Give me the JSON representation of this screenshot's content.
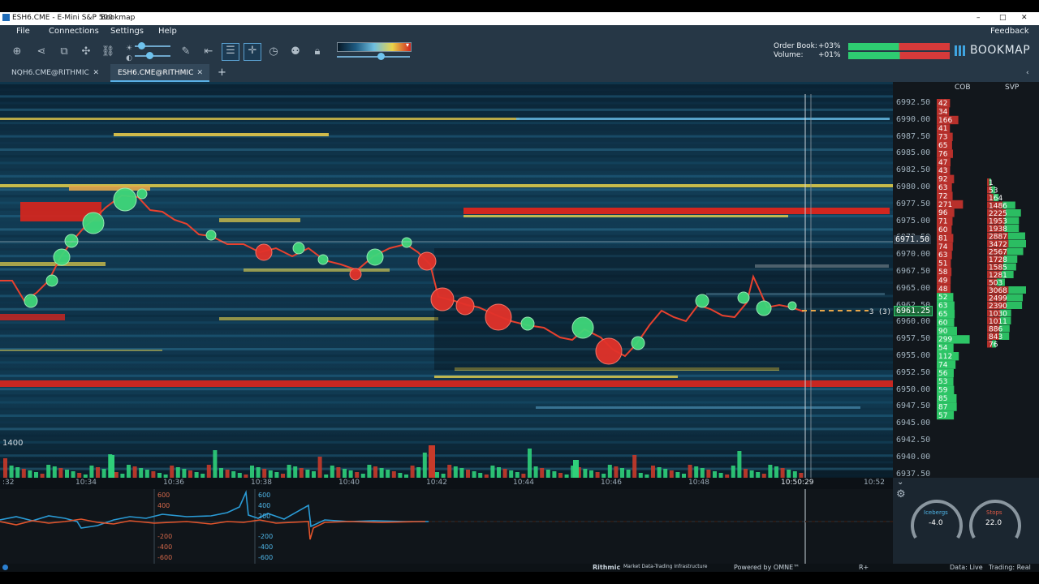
{
  "window": {
    "title": "ESH6.CME - E-Mini S&P 500",
    "app_name": "Bookmap",
    "controls": [
      "–",
      "□",
      "✕"
    ]
  },
  "menu": {
    "items": [
      "File",
      "Connections",
      "Settings",
      "Help"
    ],
    "feedback": "Feedback"
  },
  "toolbar": {
    "icons": [
      "crosshair-target-icon",
      "share-icon",
      "chart-icon",
      "network-icon",
      "link-icon",
      "brightness-icon",
      "contrast-icon",
      "pencil-icon",
      "fit-width-icon",
      "comment-icon",
      "cursor-cross-icon",
      "stopwatch-icon",
      "users-icon",
      "lock-icon"
    ],
    "order_book_label": "Order Book:",
    "order_book_value": "+03%",
    "volume_label": "Volume:",
    "volume_value": "+01%",
    "logo_text": "BOOKMAP",
    "colors": {
      "buy": "#2ecc71",
      "sell": "#d63a3a"
    }
  },
  "tabs": [
    {
      "label": "NQH6.CME@RITHMIC",
      "active": false
    },
    {
      "label": "ESH6.CME@RITHMIC",
      "active": true
    }
  ],
  "columns": {
    "cob": "COB",
    "svp": "SVP"
  },
  "price_axis": {
    "ticks": [
      "6992.50",
      "6990.00",
      "6987.50",
      "6985.00",
      "6982.50",
      "6980.00",
      "6977.50",
      "6975.00",
      "6972.50",
      "6970.00",
      "6967.50",
      "6965.00",
      "6962.50",
      "6960.00",
      "6957.50",
      "6955.00",
      "6952.50",
      "6950.00",
      "6947.50",
      "6945.00",
      "6942.50",
      "6940.00",
      "6937.50"
    ],
    "crosshair_price": "6971.50",
    "last_price": "6961.25"
  },
  "time_axis": {
    "ticks": [
      ":32",
      "10:34",
      "10:36",
      "10:38",
      "10:40",
      "10:42",
      "10:44",
      "10:46",
      "10:48",
      "10:50:29",
      "10:52"
    ]
  },
  "chart": {
    "volume_label": "1400",
    "order_label": "3 (3)",
    "colors": {
      "heat_low": "#0b2a3c",
      "heat_mid": "#1f6f95",
      "heat_high": "#e8d24a",
      "heat_max": "#d2261f"
    }
  },
  "cob_values": {
    "ask": [
      "42",
      "34",
      "166",
      "41",
      "73",
      "65",
      "76",
      "47",
      "43",
      "92",
      "63",
      "72",
      "271",
      "96",
      "71",
      "60",
      "81",
      "74",
      "63",
      "51",
      "58",
      "49",
      "48"
    ],
    "bid": [
      "52",
      "63",
      "65",
      "60",
      "90",
      "299",
      "54",
      "112",
      "74",
      "56",
      "53",
      "59",
      "85",
      "87",
      "57"
    ]
  },
  "svp_values": [
    "1",
    "53",
    "164",
    "1486",
    "2225",
    "1953",
    "1938",
    "2887",
    "3472",
    "2567",
    "1728",
    "1585",
    "1281",
    "503",
    "3068",
    "2499",
    "2390",
    "1030",
    "1011",
    "886",
    "843",
    "76"
  ],
  "lower_indicator": {
    "left_ticks": [
      "600",
      "400",
      "",
      "",
      "-200",
      "-400",
      "-600"
    ],
    "right_ticks": [
      "600",
      "400",
      "200",
      "",
      "-200",
      "-400",
      "-600"
    ]
  },
  "gauges": {
    "icebergs": {
      "label": "Icebergs",
      "value": "-4.0"
    },
    "stops": {
      "label": "Stops",
      "value": "22.0"
    }
  },
  "status": {
    "rithmic": "Rithmic",
    "tagline": "Market Data-Trading Infrastructure",
    "powered": "Powered by OMNE™",
    "r_plus": "R+",
    "data_label": "Data: Live",
    "trading_label": "Trading: Real"
  }
}
